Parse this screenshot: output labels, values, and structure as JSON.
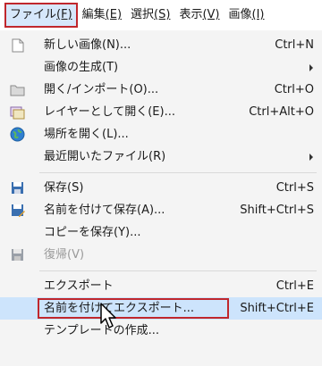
{
  "menubar": {
    "items": [
      {
        "label": "ファイル",
        "mnemonic": "(F)"
      },
      {
        "label": "編集",
        "mnemonic": "(E)"
      },
      {
        "label": "選択",
        "mnemonic": "(S)"
      },
      {
        "label": "表示",
        "mnemonic": "(V)"
      },
      {
        "label": "画像",
        "mnemonic": "(I)"
      }
    ]
  },
  "menu": {
    "items": [
      {
        "icon": "new-document-icon",
        "label": "新しい画像(N)...",
        "shortcut": "Ctrl+N"
      },
      {
        "icon": "",
        "label": "画像の生成(T)",
        "submenu": true
      },
      {
        "icon": "folder-open-icon",
        "label": "開く/インポート(O)...",
        "shortcut": "Ctrl+O"
      },
      {
        "icon": "open-as-layers-icon",
        "label": "レイヤーとして開く(E)...",
        "shortcut": "Ctrl+Alt+O"
      },
      {
        "icon": "globe-icon",
        "label": "場所を開く(L)..."
      },
      {
        "icon": "",
        "label": "最近開いたファイル(R)",
        "submenu": true
      },
      {
        "icon": "save-icon",
        "label": "保存(S)",
        "shortcut": "Ctrl+S"
      },
      {
        "icon": "save-as-icon",
        "label": "名前を付けて保存(A)...",
        "shortcut": "Shift+Ctrl+S"
      },
      {
        "icon": "",
        "label": "コピーを保存(Y)..."
      },
      {
        "icon": "revert-icon",
        "label": "復帰(V)",
        "disabled": true
      },
      {
        "icon": "",
        "label": "エクスポート",
        "shortcut": "Ctrl+E"
      },
      {
        "icon": "",
        "label": "名前を付けてエクスポート...",
        "shortcut": "Shift+Ctrl+E",
        "highlighted": true
      },
      {
        "icon": "",
        "label": "テンプレートの作成..."
      }
    ]
  },
  "colors": {
    "highlight": "#cde4fc",
    "annotation_red": "#c0272d",
    "menu_background": "#f4f4f4"
  }
}
